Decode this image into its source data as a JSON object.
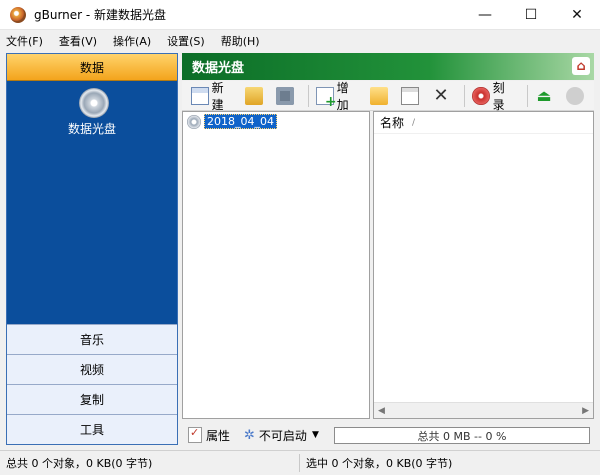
{
  "window": {
    "title": "gBurner - 新建数据光盘",
    "minimize": "—",
    "maximize": "☐",
    "close": "✕"
  },
  "menu": [
    "文件(F)",
    "查看(V)",
    "操作(A)",
    "设置(S)",
    "帮助(H)"
  ],
  "left_panel": {
    "header": "数据",
    "disc_label": "数据光盘",
    "tabs": [
      "音乐",
      "视频",
      "复制",
      "工具"
    ]
  },
  "right_panel": {
    "header": "数据光盘",
    "home_icon": "⌂"
  },
  "toolbar": {
    "new_label": "新建",
    "add_label": "增加",
    "burn_label": "刻录",
    "delete_icon": "✕",
    "eject_icon": "⏏"
  },
  "tree": {
    "item_label": "2018_04_04"
  },
  "list": {
    "column_name": "名称",
    "sort_indicator": "/",
    "scroll_left": "◀",
    "scroll_right": "▶"
  },
  "bottom": {
    "properties_label": "属性",
    "boot_label": "不可启动",
    "boot_icon": "✲",
    "caret": "▼",
    "progress_text": "总共 0 MB -- 0 %"
  },
  "status": {
    "left": "总共 0 个对象，0 KB(0 字节)",
    "right": "选中 0 个对象，0 KB(0 字节)"
  }
}
